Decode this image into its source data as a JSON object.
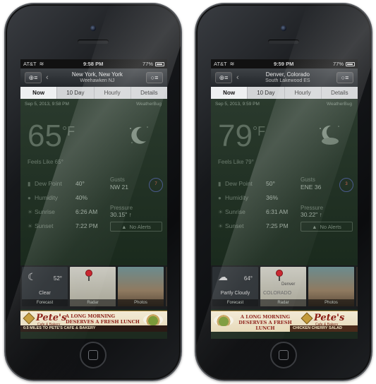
{
  "phones": [
    {
      "status": {
        "carrier": "AT&T",
        "time": "9:58 PM",
        "battery": "77%"
      },
      "nav": {
        "city": "New York, New York",
        "sub": "Weehawken NJ"
      },
      "tabs": [
        "Now",
        "10 Day",
        "Hourly",
        "Details"
      ],
      "date": "Sep 5, 2013, 9:58 PM",
      "brand": "WeatherBug",
      "temp": "65",
      "temp_unit": "°F",
      "feels_like": "Feels Like 65°",
      "stats": [
        {
          "label": "Dew Point",
          "value": "40°"
        },
        {
          "label": "Humidity",
          "value": "40%"
        },
        {
          "label": "Sunrise",
          "value": "6:26 AM"
        },
        {
          "label": "Sunset",
          "value": "7:22 PM"
        }
      ],
      "gusts": {
        "label": "Gusts",
        "value": "NW 21"
      },
      "compass": "7",
      "pressure": {
        "label": "Pressure",
        "value": "30.15\" ↑"
      },
      "alerts": "No Alerts",
      "cards": {
        "forecast_temp": "52°",
        "forecast_cond": "Clear",
        "forecast": "Forecast",
        "radar": "Radar",
        "photos": "Photos"
      },
      "ad": {
        "logo": "Pete's",
        "logo_tag": "Cafe & Bakery",
        "slogan": "A LONG MORNING DESERVES A FRESH LUNCH",
        "sub": "STEAK AND BERRIES SALAD",
        "strip": "0.5 MILES TO PETE'S CAFE & BAKERY"
      }
    },
    {
      "status": {
        "carrier": "AT&T",
        "time": "9:59 PM",
        "battery": "77%"
      },
      "nav": {
        "city": "Denver, Colorado",
        "sub": "South Lakewood ES"
      },
      "tabs": [
        "Now",
        "10 Day",
        "Hourly",
        "Details"
      ],
      "date": "Sep 5, 2013, 9:59 PM",
      "brand": "WeatherBug",
      "temp": "79",
      "temp_unit": "°F",
      "feels_like": "Feels Like 79°",
      "stats": [
        {
          "label": "Dew Point",
          "value": "50°"
        },
        {
          "label": "Humidity",
          "value": "36%"
        },
        {
          "label": "Sunrise",
          "value": "6:31 AM"
        },
        {
          "label": "Sunset",
          "value": "7:25 PM"
        }
      ],
      "gusts": {
        "label": "Gusts",
        "value": "ENE 36"
      },
      "compass": "3",
      "pressure": {
        "label": "Pressure",
        "value": "30.22\" ↑"
      },
      "alerts": "No Alerts",
      "cards": {
        "forecast_temp": "64°",
        "forecast_cond": "Partly Cloudy",
        "forecast": "Forecast",
        "radar": "Radar",
        "photos": "Photos",
        "map_label": "COLORADO",
        "map_city": "Denver"
      },
      "ad": {
        "logo": "Pete's",
        "logo_tag": "Cafe & Bakery",
        "slogan": "A LONG MORNING DESERVES A FRESH LUNCH",
        "strip": "CHICKEN CHERRY SALAD"
      }
    }
  ]
}
